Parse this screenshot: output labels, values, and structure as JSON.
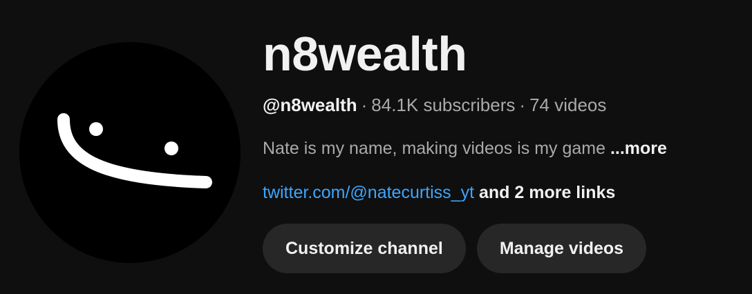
{
  "channel": {
    "name": "n8wealth",
    "handle": "@n8wealth",
    "separator": "·",
    "subscribers": "84.1K subscribers",
    "videos": "74 videos",
    "description": "Nate is my name, making videos is my game",
    "more_label": "...more",
    "link_text": "twitter.com/@natecurtiss_yt",
    "more_links": "and 2 more links",
    "avatar_icon": "smiley-face-icon"
  },
  "actions": {
    "customize_label": "Customize channel",
    "manage_label": "Manage videos"
  },
  "colors": {
    "background": "#0f0f0f",
    "link": "#3ea6ff",
    "button_bg": "#272727",
    "secondary_text": "#aaaaaa",
    "primary_text": "#f1f1f1"
  }
}
